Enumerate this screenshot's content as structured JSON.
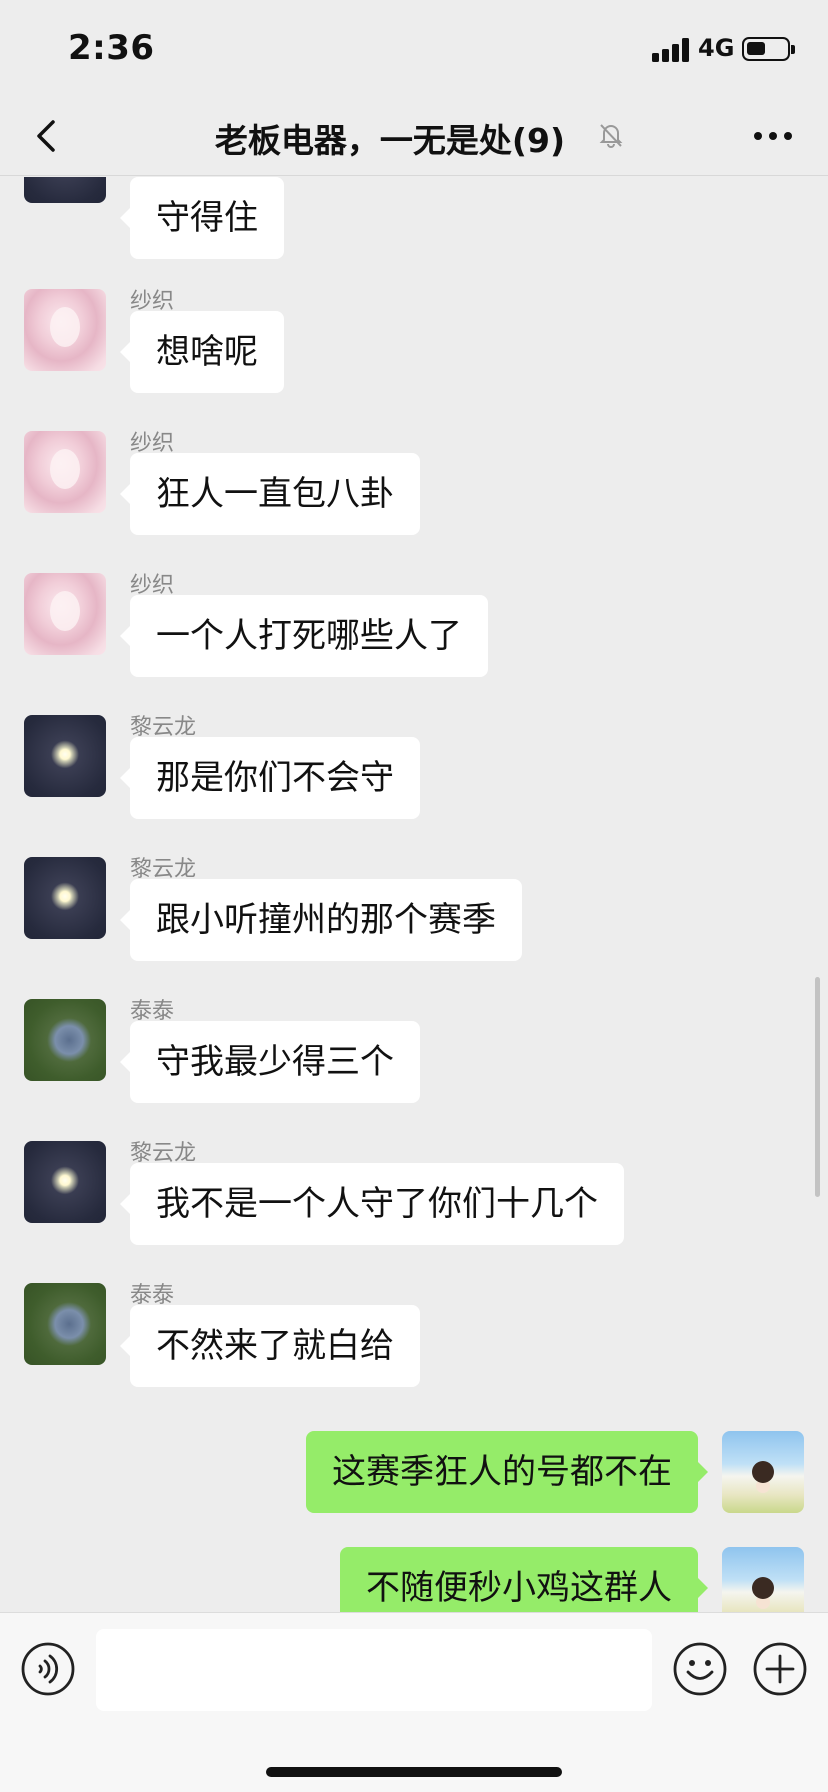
{
  "status_bar": {
    "time": "2:36",
    "network": "4G",
    "battery_level": 0.5
  },
  "nav": {
    "title": "老板电器，一无是处(9)",
    "muted": true
  },
  "messages": [
    {
      "sender": "",
      "text": "守得住",
      "avatar": "moon"
    },
    {
      "sender": "纱织",
      "text": "想啥呢",
      "avatar": "anime-girl"
    },
    {
      "sender": "纱织",
      "text": "狂人一直包八卦",
      "avatar": "anime-girl"
    },
    {
      "sender": "纱织",
      "text": "一个人打死哪些人了",
      "avatar": "anime-girl"
    },
    {
      "sender": "黎云龙",
      "text": "那是你们不会守",
      "avatar": "moon"
    },
    {
      "sender": "黎云龙",
      "text": "跟小听撞州的那个赛季",
      "avatar": "moon"
    },
    {
      "sender": "泰泰",
      "text": "守我最少得三个",
      "avatar": "grass-lying"
    },
    {
      "sender": "黎云龙",
      "text": "我不是一个人守了你们十几个",
      "avatar": "moon"
    },
    {
      "sender": "泰泰",
      "text": "不然来了就白给",
      "avatar": "grass-lying"
    }
  ],
  "outgoing": [
    {
      "text": "这赛季狂人的号都不在",
      "avatar": "anime-boy"
    },
    {
      "text": "不随便秒小鸡这群人",
      "avatar": "anime-boy"
    }
  ],
  "input": {
    "value": "",
    "placeholder": ""
  },
  "colors": {
    "background": "#ededed",
    "incoming_bubble": "#ffffff",
    "outgoing_bubble": "#95ec69",
    "sender_name": "#888888"
  }
}
